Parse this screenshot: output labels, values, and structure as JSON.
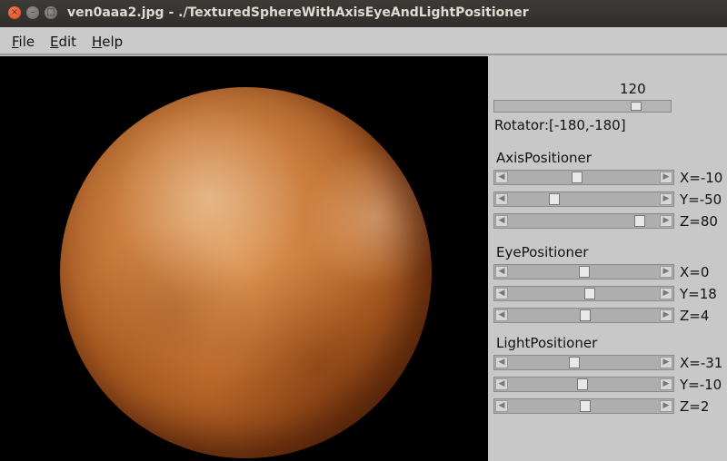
{
  "window": {
    "title": "ven0aaa2.jpg - ./TexturedSphereWithAxisEyeAndLightPositioner",
    "close_glyph": "×",
    "min_glyph": "–",
    "max_glyph": "□"
  },
  "menubar": {
    "items": [
      {
        "ul": "F",
        "rest": "ile"
      },
      {
        "ul": "E",
        "rest": "dit"
      },
      {
        "ul": "H",
        "rest": "elp"
      }
    ]
  },
  "rotator": {
    "value": "120",
    "fraction": 0.83,
    "label": "Rotator:[-180,-180]"
  },
  "groups": [
    {
      "title": "AxisPositioner",
      "sliders": [
        {
          "label": "X=-10",
          "fraction": 0.45
        },
        {
          "label": "Y=-50",
          "fraction": 0.29
        },
        {
          "label": "Z=80",
          "fraction": 0.9
        }
      ]
    },
    {
      "title": "EyePositioner",
      "sliders": [
        {
          "label": "X=0",
          "fraction": 0.5
        },
        {
          "label": "Y=18",
          "fraction": 0.54
        },
        {
          "label": "Z=4",
          "fraction": 0.51
        }
      ]
    },
    {
      "title": "LightPositioner",
      "sliders": [
        {
          "label": "X=-31",
          "fraction": 0.43
        },
        {
          "label": "Y=-10",
          "fraction": 0.49
        },
        {
          "label": "Z=2",
          "fraction": 0.51
        }
      ]
    }
  ],
  "colors": {
    "titlebar": "#3c3b37",
    "planet": "#c06d2c",
    "canvas": "#000000",
    "panel": "#c8c8c8"
  }
}
